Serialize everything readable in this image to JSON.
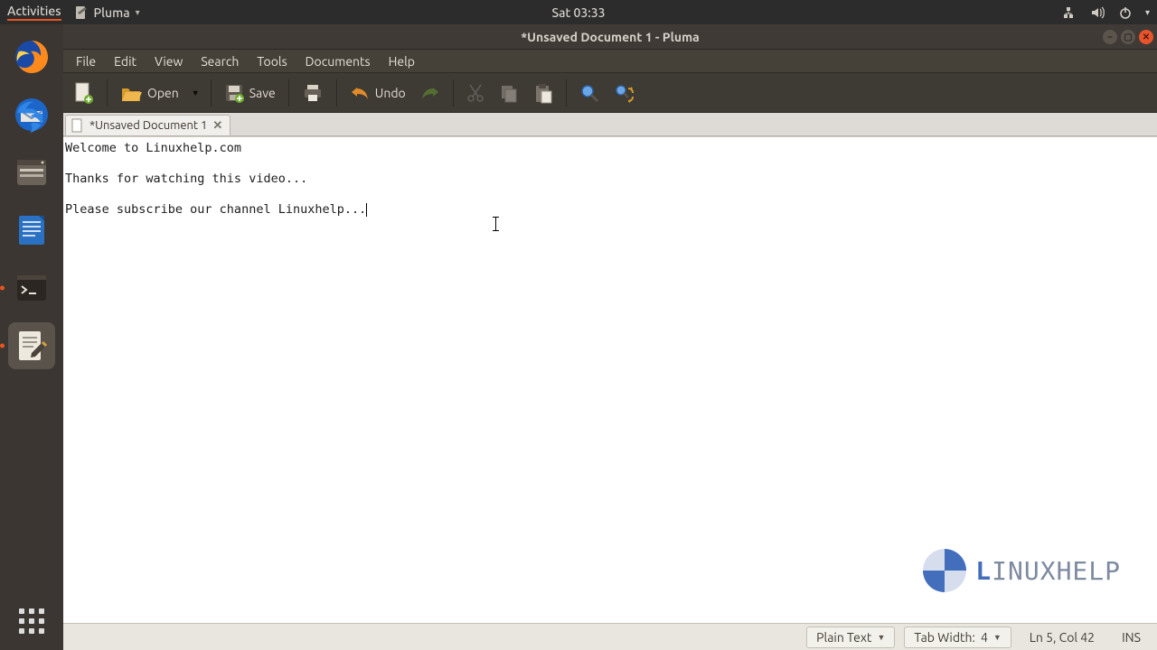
{
  "panel": {
    "activities": "Activities",
    "app_name": "Pluma",
    "clock": "Sat 03:33"
  },
  "dock": {
    "items": [
      {
        "name": "firefox"
      },
      {
        "name": "thunderbird"
      },
      {
        "name": "files"
      },
      {
        "name": "libreoffice-writer"
      },
      {
        "name": "terminal"
      },
      {
        "name": "text-editor"
      }
    ]
  },
  "window": {
    "title": "*Unsaved Document 1 - Pluma"
  },
  "menubar": {
    "items": [
      "File",
      "Edit",
      "View",
      "Search",
      "Tools",
      "Documents",
      "Help"
    ]
  },
  "toolbar": {
    "open_label": "Open",
    "save_label": "Save",
    "undo_label": "Undo"
  },
  "tabs": [
    {
      "label": "*Unsaved Document 1"
    }
  ],
  "editor": {
    "line1": "Welcome to Linuxhelp.com",
    "line2": "",
    "line3": "Thanks for watching this video...",
    "line4": "",
    "line5": "Please subscribe our channel Linuxhelp..."
  },
  "watermark": {
    "brand_first": "L",
    "brand_rest": "INUXHELP"
  },
  "statusbar": {
    "syntax": "Plain Text",
    "tab_label": "Tab Width:",
    "tab_value": "4",
    "position": "Ln 5, Col 42",
    "insert_mode": "INS"
  }
}
